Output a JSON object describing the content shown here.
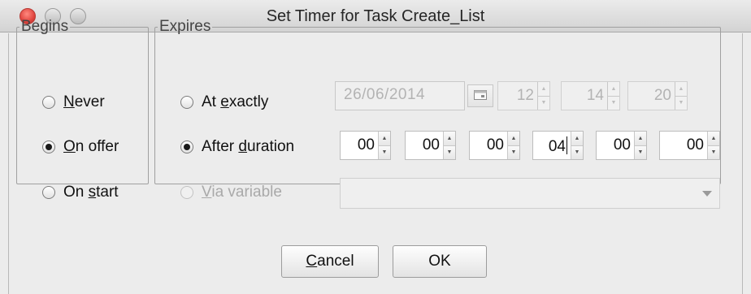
{
  "window": {
    "title": "Set Timer for Task Create_List"
  },
  "begins": {
    "legend": "Begins",
    "options": [
      {
        "label": "Never",
        "mnemonic": "N",
        "rest": "ever",
        "checked": false
      },
      {
        "label": "On offer",
        "mnemonic": "O",
        "rest": "n offer",
        "checked": true
      },
      {
        "label": "On start",
        "prefix": "On ",
        "mnemonic": "s",
        "rest": "tart",
        "checked": false
      }
    ]
  },
  "expires": {
    "legend": "Expires",
    "at_exactly": {
      "prefix": "At ",
      "mnemonic": "e",
      "rest": "xactly",
      "checked": false,
      "date": "26/06/2014",
      "hour": "12",
      "minute": "14",
      "second": "20"
    },
    "after_duration": {
      "prefix": "After ",
      "mnemonic": "d",
      "rest": "uration",
      "checked": true,
      "values": [
        "00",
        "00",
        "00",
        "04",
        "00",
        "00"
      ]
    },
    "via_variable": {
      "mnemonic": "V",
      "rest": "ia variable",
      "checked": false,
      "enabled": false,
      "selected": ""
    }
  },
  "buttons": {
    "cancel_mnemonic": "C",
    "cancel_rest": "ancel",
    "ok": "OK"
  }
}
